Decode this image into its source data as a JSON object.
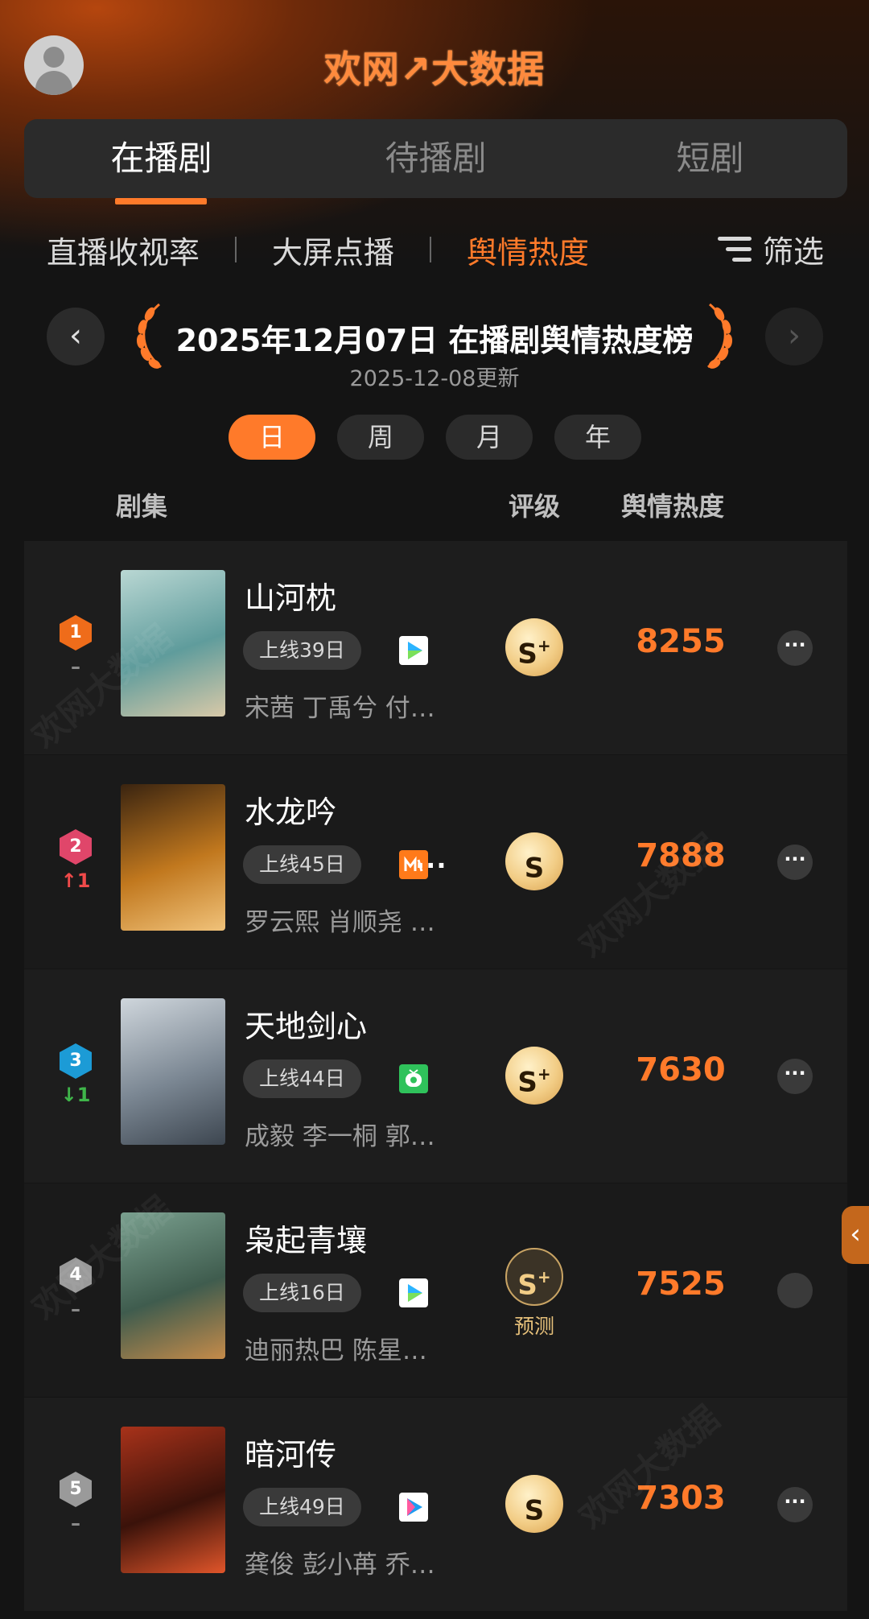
{
  "header": {
    "logo_text": "欢网↗大数据",
    "avatar_icon": "user-avatar-icon"
  },
  "main_tabs": [
    {
      "label": "在播剧",
      "active": true
    },
    {
      "label": "待播剧",
      "active": false
    },
    {
      "label": "短剧",
      "active": false
    }
  ],
  "sub_tabs": [
    {
      "label": "直播收视率",
      "active": false
    },
    {
      "label": "大屏点播",
      "active": false
    },
    {
      "label": "舆情热度",
      "active": true
    }
  ],
  "filter": {
    "label": "筛选",
    "icon": "filter-lines-icon"
  },
  "date_nav": {
    "title": "2025年12月07日 在播剧舆情热度榜",
    "updated": "2025-12-08更新",
    "prev_icon": "chevron-left-icon",
    "next_icon": "chevron-right-icon"
  },
  "period_tabs": [
    {
      "label": "日",
      "active": true
    },
    {
      "label": "周",
      "active": false
    },
    {
      "label": "月",
      "active": false
    },
    {
      "label": "年",
      "active": false
    }
  ],
  "columns": {
    "series": "剧集",
    "grade": "评级",
    "heat": "舆情热度"
  },
  "rows": [
    {
      "rank": "1",
      "change": "–",
      "change_color": "#8a8a8a",
      "badge_color": "#ef6c1a",
      "title": "山河枕",
      "online": "上线39日",
      "platforms": [
        {
          "icon": "play-triangle-icon",
          "colors": [
            "#ffffff",
            "#2bb4ff"
          ]
        }
      ],
      "platform_more": "",
      "cast": "宋茜 丁禹兮 付…",
      "grade_letter": "S",
      "grade_plus": "+",
      "predict": "",
      "heat": "8255",
      "poster": [
        "#b9d7d3",
        "#5f9c9c",
        "#d8c9a8"
      ]
    },
    {
      "rank": "2",
      "change": "↑1",
      "change_color": "#f04a4a",
      "badge_color": "#e0466a",
      "title": "水龙吟",
      "online": "上线45日",
      "platforms": [
        {
          "icon": "mangotv-icon",
          "colors": [
            "#ff7a1a",
            "#ffffff"
          ]
        }
      ],
      "platform_more": "...",
      "cast": "罗云熙 肖顺尧 …",
      "grade_letter": "S",
      "grade_plus": "",
      "predict": "",
      "heat": "7888",
      "poster": [
        "#3a2410",
        "#c1781e",
        "#f0c27a"
      ]
    },
    {
      "rank": "3",
      "change": "↓1",
      "change_color": "#3fb54a",
      "badge_color": "#1c9bd6",
      "title": "天地剑心",
      "online": "上线44日",
      "platforms": [
        {
          "icon": "iqiyi-tv-icon",
          "colors": [
            "#2fc25b",
            "#ffffff"
          ]
        }
      ],
      "platform_more": "",
      "cast": "成毅 李一桐 郭…",
      "grade_letter": "S",
      "grade_plus": "+",
      "predict": "",
      "heat": "7630",
      "poster": [
        "#cfd6dc",
        "#7b8793",
        "#3d4650"
      ]
    },
    {
      "rank": "4",
      "change": "–",
      "change_color": "#8a8a8a",
      "badge_color": "#9a9a9a",
      "title": "枭起青壤",
      "online": "上线16日",
      "platforms": [
        {
          "icon": "play-triangle-icon",
          "colors": [
            "#ffffff",
            "#2bb4ff"
          ]
        }
      ],
      "platform_more": "",
      "cast": "迪丽热巴 陈星…",
      "grade_letter": "S",
      "grade_plus": "+",
      "predict": "预测",
      "heat": "7525",
      "poster": [
        "#7aa08f",
        "#3f5c4e",
        "#c58b4a"
      ]
    },
    {
      "rank": "5",
      "change": "–",
      "change_color": "#8a8a8a",
      "badge_color": "#9a9a9a",
      "title": "暗河传",
      "online": "上线49日",
      "platforms": [
        {
          "icon": "youku-icon",
          "colors": [
            "#ffffff",
            "#1d9bf0"
          ]
        }
      ],
      "platform_more": "",
      "cast": "龚俊 彭小苒 乔…",
      "grade_letter": "S",
      "grade_plus": "",
      "predict": "",
      "heat": "7303",
      "poster": [
        "#a8321a",
        "#3a120a",
        "#e0552a"
      ]
    }
  ],
  "side_handle_icon": "chevron-left-icon",
  "watermark_text": "欢网大数据"
}
